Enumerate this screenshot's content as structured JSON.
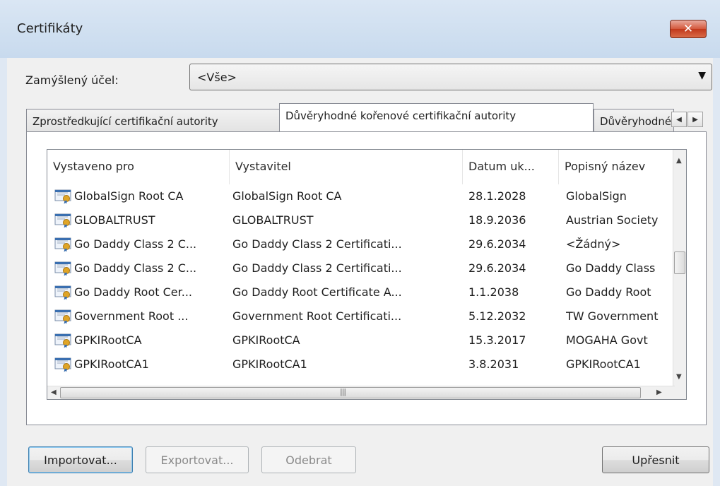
{
  "window": {
    "title": "Certifikáty",
    "close_label": "✕"
  },
  "purpose": {
    "label": "Zamýšlený účel:",
    "value": "<Vše>"
  },
  "tabs": [
    {
      "label": "Zprostředkující certifikační autority"
    },
    {
      "label": "Důvěryhodné kořenové certifikační autority"
    },
    {
      "label": "Důvěryhodné"
    }
  ],
  "list": {
    "columns": [
      "Vystaveno pro",
      "Vystavitel",
      "Datum uk...",
      "Popisný název"
    ],
    "rows": [
      {
        "issued_to": "GlobalSign Root CA",
        "issuer": "GlobalSign Root CA",
        "expires": "28.1.2028",
        "friendly": "GlobalSign"
      },
      {
        "issued_to": "GLOBALTRUST",
        "issuer": "GLOBALTRUST",
        "expires": "18.9.2036",
        "friendly": "Austrian Society"
      },
      {
        "issued_to": "Go Daddy Class 2 C...",
        "issuer": "Go Daddy Class 2 Certificati...",
        "expires": "29.6.2034",
        "friendly": "<Žádný>"
      },
      {
        "issued_to": "Go Daddy Class 2 C...",
        "issuer": "Go Daddy Class 2 Certificati...",
        "expires": "29.6.2034",
        "friendly": "Go Daddy Class"
      },
      {
        "issued_to": "Go Daddy Root Cer...",
        "issuer": "Go Daddy Root Certificate A...",
        "expires": "1.1.2038",
        "friendly": "Go Daddy Root"
      },
      {
        "issued_to": "Government Root ...",
        "issuer": "Government Root Certificati...",
        "expires": "5.12.2032",
        "friendly": "TW Government"
      },
      {
        "issued_to": "GPKIRootCA",
        "issuer": "GPKIRootCA",
        "expires": "15.3.2017",
        "friendly": "MOGAHA Govt"
      },
      {
        "issued_to": "GPKIRootCA1",
        "issuer": "GPKIRootCA1",
        "expires": "3.8.2031",
        "friendly": "GPKIRootCA1"
      }
    ]
  },
  "buttons": {
    "import": "Importovat...",
    "export": "Exportovat...",
    "remove": "Odebrat",
    "advanced": "Upřesnit"
  },
  "colors": {
    "window_bg": "#dfe8f3",
    "client_bg": "#f0f0f0",
    "close_red": "#c2391c",
    "cert_icon_gold": "#e0a526",
    "cert_icon_blue": "#3a6fb0"
  }
}
